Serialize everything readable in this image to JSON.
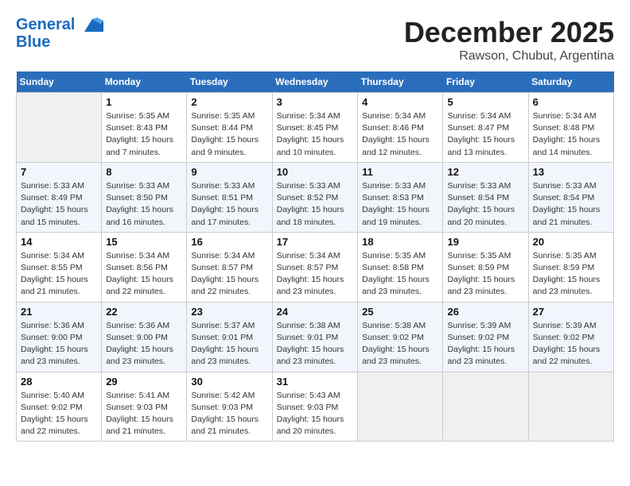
{
  "header": {
    "logo_line1": "General",
    "logo_line2": "Blue",
    "month": "December 2025",
    "location": "Rawson, Chubut, Argentina"
  },
  "days_of_week": [
    "Sunday",
    "Monday",
    "Tuesday",
    "Wednesday",
    "Thursday",
    "Friday",
    "Saturday"
  ],
  "weeks": [
    [
      {
        "day": "",
        "info": ""
      },
      {
        "day": "1",
        "info": "Sunrise: 5:35 AM\nSunset: 8:43 PM\nDaylight: 15 hours\nand 7 minutes."
      },
      {
        "day": "2",
        "info": "Sunrise: 5:35 AM\nSunset: 8:44 PM\nDaylight: 15 hours\nand 9 minutes."
      },
      {
        "day": "3",
        "info": "Sunrise: 5:34 AM\nSunset: 8:45 PM\nDaylight: 15 hours\nand 10 minutes."
      },
      {
        "day": "4",
        "info": "Sunrise: 5:34 AM\nSunset: 8:46 PM\nDaylight: 15 hours\nand 12 minutes."
      },
      {
        "day": "5",
        "info": "Sunrise: 5:34 AM\nSunset: 8:47 PM\nDaylight: 15 hours\nand 13 minutes."
      },
      {
        "day": "6",
        "info": "Sunrise: 5:34 AM\nSunset: 8:48 PM\nDaylight: 15 hours\nand 14 minutes."
      }
    ],
    [
      {
        "day": "7",
        "info": "Sunrise: 5:33 AM\nSunset: 8:49 PM\nDaylight: 15 hours\nand 15 minutes."
      },
      {
        "day": "8",
        "info": "Sunrise: 5:33 AM\nSunset: 8:50 PM\nDaylight: 15 hours\nand 16 minutes."
      },
      {
        "day": "9",
        "info": "Sunrise: 5:33 AM\nSunset: 8:51 PM\nDaylight: 15 hours\nand 17 minutes."
      },
      {
        "day": "10",
        "info": "Sunrise: 5:33 AM\nSunset: 8:52 PM\nDaylight: 15 hours\nand 18 minutes."
      },
      {
        "day": "11",
        "info": "Sunrise: 5:33 AM\nSunset: 8:53 PM\nDaylight: 15 hours\nand 19 minutes."
      },
      {
        "day": "12",
        "info": "Sunrise: 5:33 AM\nSunset: 8:54 PM\nDaylight: 15 hours\nand 20 minutes."
      },
      {
        "day": "13",
        "info": "Sunrise: 5:33 AM\nSunset: 8:54 PM\nDaylight: 15 hours\nand 21 minutes."
      }
    ],
    [
      {
        "day": "14",
        "info": "Sunrise: 5:34 AM\nSunset: 8:55 PM\nDaylight: 15 hours\nand 21 minutes."
      },
      {
        "day": "15",
        "info": "Sunrise: 5:34 AM\nSunset: 8:56 PM\nDaylight: 15 hours\nand 22 minutes."
      },
      {
        "day": "16",
        "info": "Sunrise: 5:34 AM\nSunset: 8:57 PM\nDaylight: 15 hours\nand 22 minutes."
      },
      {
        "day": "17",
        "info": "Sunrise: 5:34 AM\nSunset: 8:57 PM\nDaylight: 15 hours\nand 23 minutes."
      },
      {
        "day": "18",
        "info": "Sunrise: 5:35 AM\nSunset: 8:58 PM\nDaylight: 15 hours\nand 23 minutes."
      },
      {
        "day": "19",
        "info": "Sunrise: 5:35 AM\nSunset: 8:59 PM\nDaylight: 15 hours\nand 23 minutes."
      },
      {
        "day": "20",
        "info": "Sunrise: 5:35 AM\nSunset: 8:59 PM\nDaylight: 15 hours\nand 23 minutes."
      }
    ],
    [
      {
        "day": "21",
        "info": "Sunrise: 5:36 AM\nSunset: 9:00 PM\nDaylight: 15 hours\nand 23 minutes."
      },
      {
        "day": "22",
        "info": "Sunrise: 5:36 AM\nSunset: 9:00 PM\nDaylight: 15 hours\nand 23 minutes."
      },
      {
        "day": "23",
        "info": "Sunrise: 5:37 AM\nSunset: 9:01 PM\nDaylight: 15 hours\nand 23 minutes."
      },
      {
        "day": "24",
        "info": "Sunrise: 5:38 AM\nSunset: 9:01 PM\nDaylight: 15 hours\nand 23 minutes."
      },
      {
        "day": "25",
        "info": "Sunrise: 5:38 AM\nSunset: 9:02 PM\nDaylight: 15 hours\nand 23 minutes."
      },
      {
        "day": "26",
        "info": "Sunrise: 5:39 AM\nSunset: 9:02 PM\nDaylight: 15 hours\nand 23 minutes."
      },
      {
        "day": "27",
        "info": "Sunrise: 5:39 AM\nSunset: 9:02 PM\nDaylight: 15 hours\nand 22 minutes."
      }
    ],
    [
      {
        "day": "28",
        "info": "Sunrise: 5:40 AM\nSunset: 9:02 PM\nDaylight: 15 hours\nand 22 minutes."
      },
      {
        "day": "29",
        "info": "Sunrise: 5:41 AM\nSunset: 9:03 PM\nDaylight: 15 hours\nand 21 minutes."
      },
      {
        "day": "30",
        "info": "Sunrise: 5:42 AM\nSunset: 9:03 PM\nDaylight: 15 hours\nand 21 minutes."
      },
      {
        "day": "31",
        "info": "Sunrise: 5:43 AM\nSunset: 9:03 PM\nDaylight: 15 hours\nand 20 minutes."
      },
      {
        "day": "",
        "info": ""
      },
      {
        "day": "",
        "info": ""
      },
      {
        "day": "",
        "info": ""
      }
    ]
  ]
}
